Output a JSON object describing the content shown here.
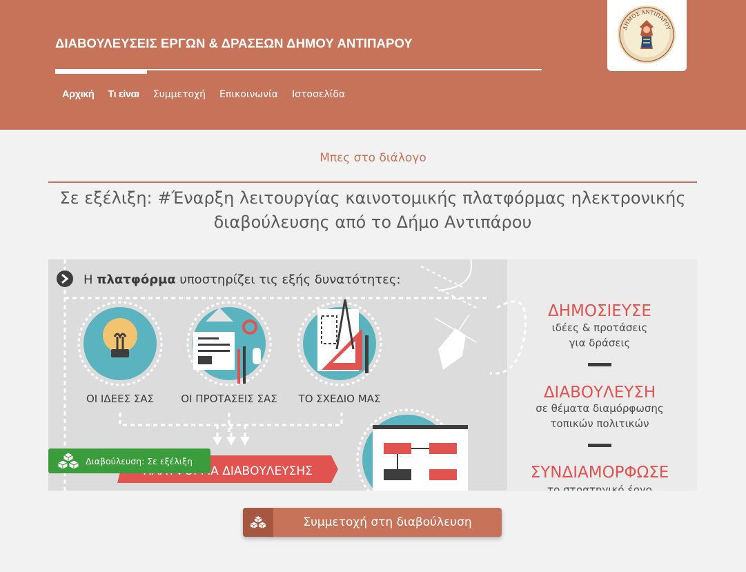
{
  "header": {
    "site_title": "ΔΙΑΒΟΥΛΕΥΣΕΙΣ ΕΡΓΩΝ & ΔΡΑΣΕΩΝ ΔΗΜΟΥ ΑΝΤΙΠΑΡΟΥ",
    "logo_text": "ΔΗΜΟΣ ΑΝΤΙΠΑΡΟΥ",
    "nav": [
      "Αρχική",
      "Τι είναι",
      "Συμμετοχή",
      "Επικοινωνία",
      "Ιστοσελίδα"
    ]
  },
  "main": {
    "dialog_link": "Μπες στο διάλογο",
    "title": "Σε εξέλιξη: #Έναρξη λειτουργίας καινοτομικής πλατφόρμας ηλεκτρονικής διαβούλευσης από το Δήμο Αντιπάρου",
    "status_badge": "Διαβούλευση: Σε εξέλιξη",
    "cta": "Συμμετοχή στη διαβούλευση"
  },
  "infographic": {
    "intro_pre": "Η ",
    "intro_bold": "πλατφόρμα",
    "intro_post": " υποστηρίζει τις εξής δυνατότητες:",
    "item1": "ΟΙ ΙΔΕΕΣ ΣΑΣ",
    "item2": "ΟΙ ΠΡΟΤΑΣΕΙΣ ΣΑΣ",
    "item3": "ΤΟ ΣΧΕΔΙΟ ΜΑΣ",
    "platform_banner": "ΠΛΑΤΦΟΡΜΑ ΔΙΑΒΟΥΛΕΥΣΗΣ",
    "h1": "ΔΗΜΟΣΙΕΥΣΕ",
    "s1a": "ιδέες & προτάσεις",
    "s1b": "για δράσεις",
    "h2": "ΔΙΑΒΟΥΛΕΥΣΗ",
    "s2a": "σε θέματα διαμόρφωσης",
    "s2b": "τοπικών πολιτικών",
    "h3": "ΣΥΝΔΙΑΜΟΡΦΩΣΕ",
    "s3a": "το στρατηγικό έργο"
  },
  "colors": {
    "brand": "#c6735a",
    "badge_green": "#3a9c3a",
    "accent_red": "#e1534f",
    "teal": "#5ab4bf"
  }
}
